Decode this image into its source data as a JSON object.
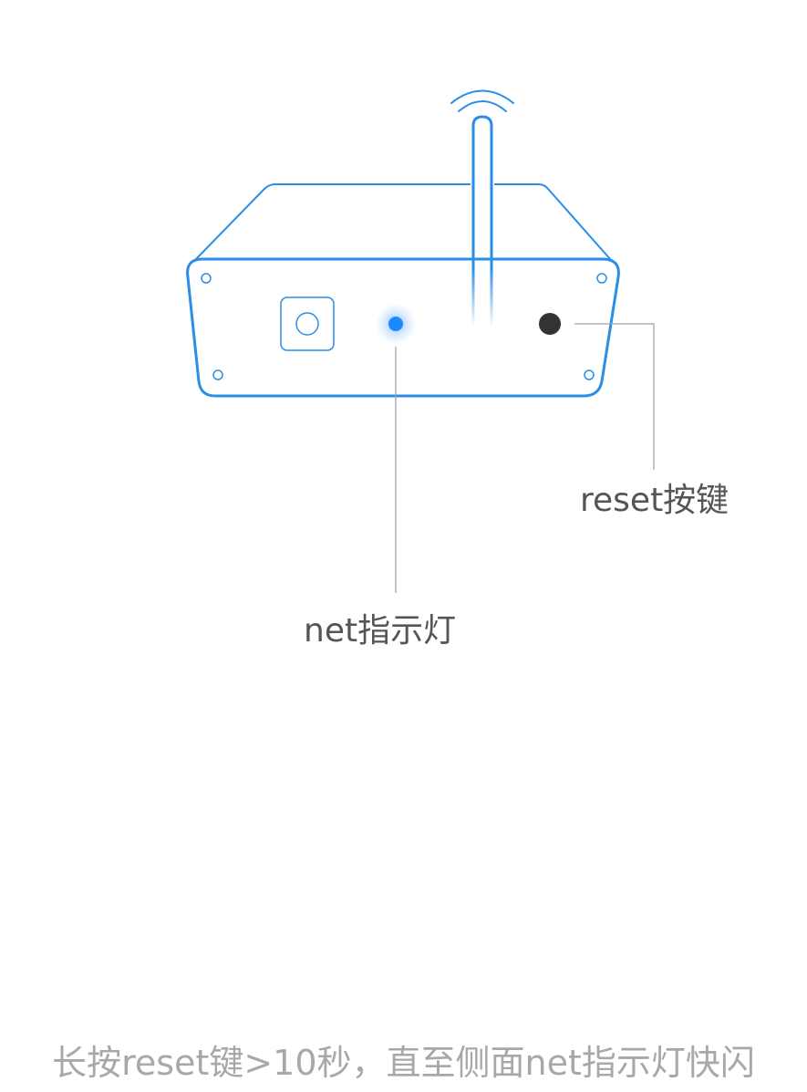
{
  "labels": {
    "reset_button": "reset按键",
    "net_indicator": "net指示灯"
  },
  "instruction": "长按reset键>10秒，直至侧面net指示灯快闪",
  "colors": {
    "outline": "#2a8ee8",
    "indicator": "#1e88ff",
    "reset_button": "#333333",
    "leader_line": "#a0a0a0",
    "label_text": "#555555",
    "instruction_text": "#a8a8a8"
  },
  "icons": {
    "device": "router-icon",
    "antenna": "antenna-icon",
    "wifi_signal": "wifi-signal-icon",
    "power_button": "power-button-icon",
    "net_led": "net-led-icon",
    "reset": "reset-button-icon"
  }
}
